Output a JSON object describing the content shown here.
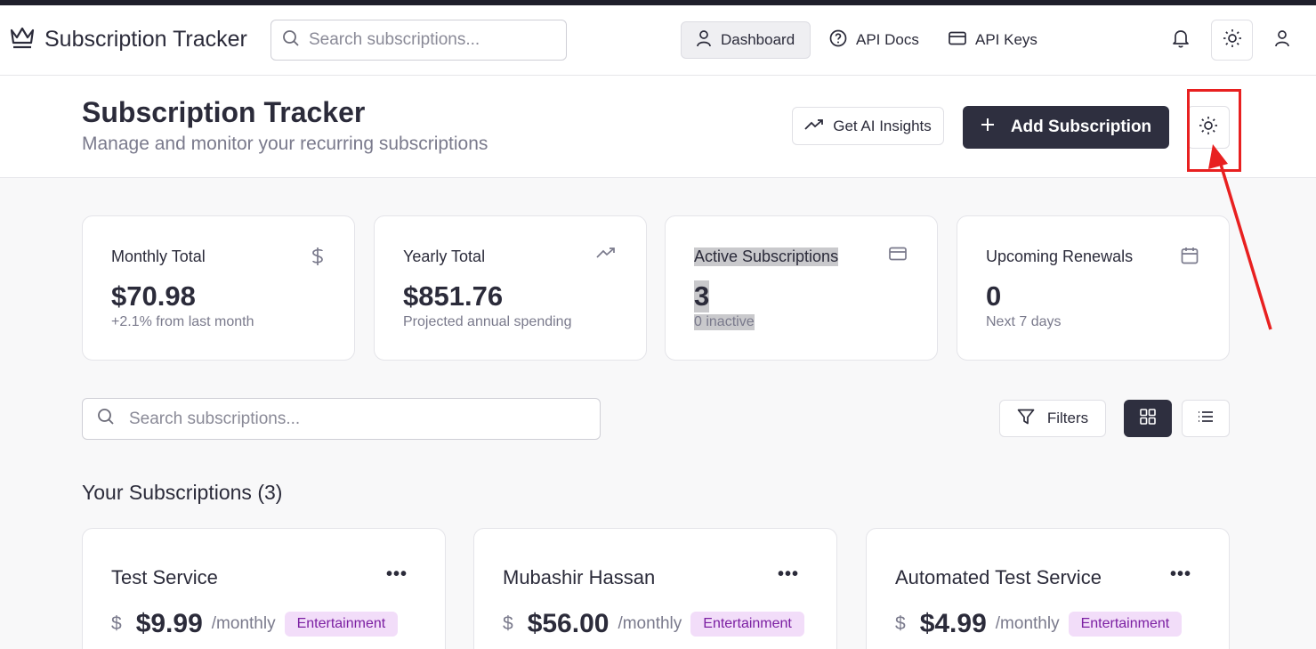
{
  "app": {
    "title": "Subscription Tracker"
  },
  "nav": {
    "search_placeholder": "Search subscriptions...",
    "items": [
      {
        "label": "Dashboard",
        "icon": "user-icon",
        "active": true
      },
      {
        "label": "API Docs",
        "icon": "help-circle-icon"
      },
      {
        "label": "API Keys",
        "icon": "credit-card-icon"
      }
    ]
  },
  "header": {
    "title": "Subscription Tracker",
    "subtitle": "Manage and monitor your recurring subscriptions",
    "ai_button": "Get AI Insights",
    "add_button": "Add Subscription"
  },
  "stats": [
    {
      "label": "Monthly Total",
      "value": "$70.98",
      "note": "+2.1% from last month",
      "icon": "dollar-icon"
    },
    {
      "label": "Yearly Total",
      "value": "$851.76",
      "note": "Projected annual spending",
      "icon": "trending-up-icon"
    },
    {
      "label": "Active Subscriptions",
      "value": "3",
      "note": "0 inactive",
      "icon": "credit-card-icon"
    },
    {
      "label": "Upcoming Renewals",
      "value": "0",
      "note": "Next 7 days",
      "icon": "calendar-icon"
    }
  ],
  "list": {
    "search_placeholder": "Search subscriptions...",
    "filters_label": "Filters",
    "section_title": "Your Subscriptions (3)"
  },
  "subscriptions": [
    {
      "name": "Test Service",
      "currency": "$",
      "amount": "$9.99",
      "period": "/monthly",
      "category": "Entertainment"
    },
    {
      "name": "Mubashir Hassan",
      "currency": "$",
      "amount": "$56.00",
      "period": "/monthly",
      "category": "Entertainment"
    },
    {
      "name": "Automated Test Service",
      "currency": "$",
      "amount": "$4.99",
      "period": "/monthly",
      "category": "Entertainment"
    }
  ],
  "colors": {
    "primary": "#2e2f3f",
    "badge_bg": "#f2ddf9",
    "badge_text": "#7b1fa2",
    "annotation": "#e82020"
  }
}
